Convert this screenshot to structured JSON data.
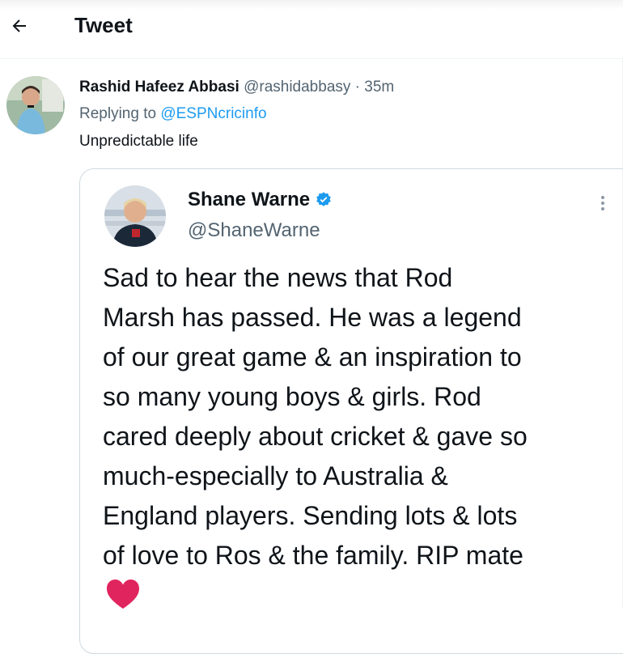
{
  "header": {
    "title": "Tweet",
    "back_icon": "arrow-left-icon"
  },
  "tweet": {
    "author_name": "Rashid Hafeez Abbasi",
    "author_handle": "@rashidabbasy",
    "separator": "·",
    "time": "35m",
    "replying_prefix": "Replying to",
    "replying_to": "@ESPNcricinfo",
    "text": "Unpredictable life"
  },
  "quoted_tweet": {
    "author_name": "Shane Warne",
    "verified_icon": "verified-badge-icon",
    "author_handle": "@ShaneWarne",
    "text": "Sad to hear the news that Rod\nMarsh has passed. He was a legend\nof our great game & an inspiration to\nso many young boys &  girls. Rod\ncared deeply about cricket & gave so\nmuch-especially to Australia &\nEngland players. Sending lots & lots\nof love to Ros & the family. RIP mate",
    "emoji": "red-heart-icon",
    "more_icon": "more-vertical-icon"
  },
  "colors": {
    "accent": "#1d9bf0",
    "secondary_text": "#536471",
    "primary_text": "#0f1419",
    "border": "#cfd9de",
    "heart": "#e0245e"
  }
}
